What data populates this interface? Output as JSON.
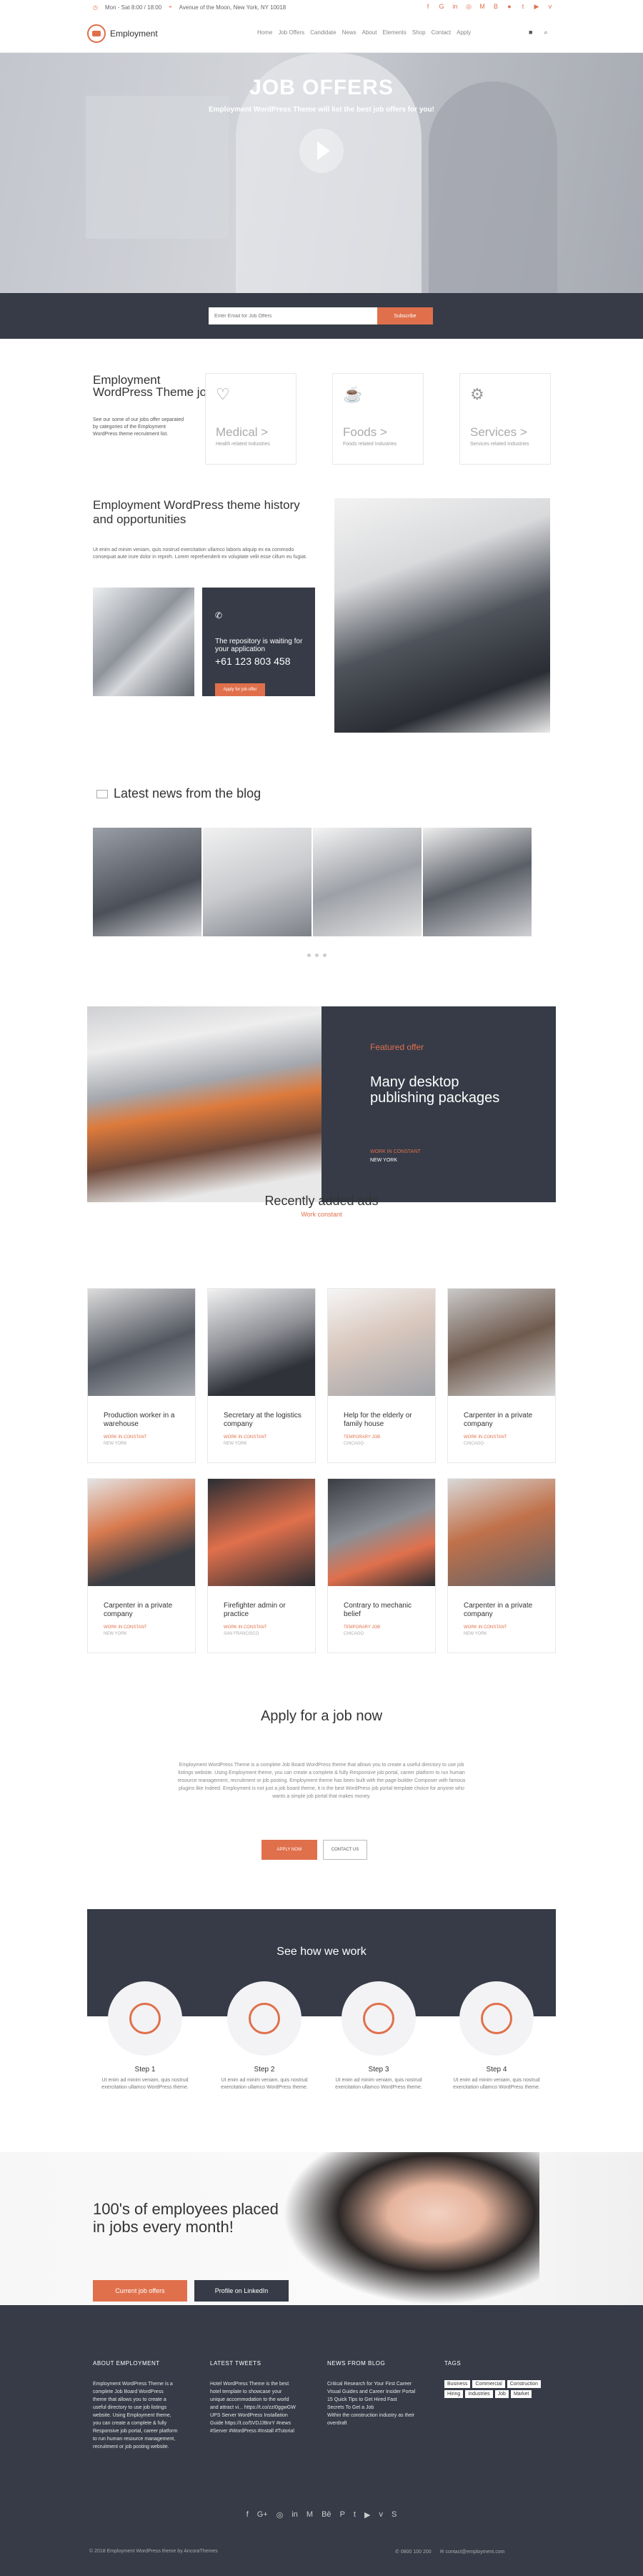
{
  "topbar": {
    "hours": "Mon - Sat 8:00 / 18:00",
    "address": "Avenue of the Moon, New York, NY 10018"
  },
  "brand": {
    "name": "Employment"
  },
  "menu": [
    "Home",
    "Job Offers",
    "Candidate",
    "News",
    "About",
    "Elements",
    "Shop",
    "Contact",
    "Apply"
  ],
  "hero": {
    "title": "JOB OFFERS",
    "subtitle": "Employment WordPress Theme will list the best job offers for you!",
    "email_placeholder": "Enter Email for Job Offers",
    "subscribe": "Subscribe"
  },
  "jobs": {
    "title": "Employment WordPress Theme jobs",
    "desc": "See our some of our jobs offer separated by categories of the Employment WordPress theme recruitment list.",
    "categories": [
      {
        "name": "Medical >",
        "sub": "Health related Industries"
      },
      {
        "name": "Foods >",
        "sub": "Foods related Industries"
      },
      {
        "name": "Services >",
        "sub": "Services related Industries"
      }
    ]
  },
  "history": {
    "title": "Employment WordPress theme history and opportunities",
    "desc": "Ut enim ad minim veniam, quis nostrud exercitation ullamco laboris aliquip ex ea commodo consequat aute irure dolor in repreh. Lorem reprehenderit ex voluptate velit esse cillum eu fugiat.",
    "repo_text": "The repository is waiting for your application",
    "phone": "+61 123 803 458",
    "apply": "Apply for job offer"
  },
  "blog": {
    "title": "Latest news from the blog"
  },
  "featured": {
    "label": "Featured offer",
    "title": "Many desktop publishing packages",
    "company": "WORK IN CONSTANT",
    "location": "NEW YORK"
  },
  "ads": {
    "title": "Recently added ads",
    "subtitle": "Work constant",
    "items": [
      {
        "title": "Production worker in a warehouse",
        "company": "WORK IN CONSTANT",
        "location": "NEW YORK"
      },
      {
        "title": "Secretary at the logistics company",
        "company": "WORK IN CONSTANT",
        "location": "NEW YORK"
      },
      {
        "title": "Help for the elderly or family house",
        "company": "TEMPORARY JOB",
        "location": "CHICAGO"
      },
      {
        "title": "Carpenter in a private company",
        "company": "WORK IN CONSTANT",
        "location": "CHICAGO"
      },
      {
        "title": "Carpenter in a private company",
        "company": "WORK IN CONSTANT",
        "location": "NEW YORK"
      },
      {
        "title": "Firefighter admin or practice",
        "company": "WORK IN CONSTANT",
        "location": "SAN FRANCISCO"
      },
      {
        "title": "Contrary to mechanic belief",
        "company": "TEMPORARY JOB",
        "location": "CHICAGO"
      },
      {
        "title": "Carpenter in a private company",
        "company": "WORK IN CONSTANT",
        "location": "NEW YORK"
      }
    ]
  },
  "apply": {
    "title": "Apply for a job now",
    "desc": "Employment WordPress Theme is a complete Job Board WordPress theme that allows you to create a useful directory to use job listings website. Using Employment theme, you can create a complete & fully Responsive job portal, career platform to run human resource management, recruitment or job posting. Employment theme has been built with the page-builder Composer with famous plugins like Indeed. Employment is not just a job board theme, it is the best WordPress job portal template choice for anyone who wants a simple job portal that makes money.",
    "apply_btn": "APPLY NOW",
    "contact_btn": "CONTACT US"
  },
  "how": {
    "title": "See how we work",
    "steps": [
      {
        "title": "Step 1",
        "desc": "Ut enim ad minim veniam, quis nostrud exercitation ullamco WordPress theme."
      },
      {
        "title": "Step 2",
        "desc": "Ut enim ad minim veniam, quis nostrud exercitation ullamco WordPress theme."
      },
      {
        "title": "Step 3",
        "desc": "Ut enim ad minim veniam, quis nostrud exercitation ullamco WordPress theme."
      },
      {
        "title": "Step 4",
        "desc": "Ut enim ad minim veniam, quis nostrud exercitation ullamco WordPress theme."
      }
    ]
  },
  "promo": {
    "title": "100's of employees placed in jobs every month!",
    "btn1": "Current job offers",
    "btn2": "Profile on LinkedIn"
  },
  "footer": {
    "about_head": "ABOUT EMPLOYMENT",
    "about": "Employment WordPress Theme is a complete Job Board WordPress theme that allows you to create a useful directory to use job listings website. Using Employment theme, you can create a complete & fully Responsive job portal, career platform to run human resource management, recruitment or job posting website.",
    "tweets_head": "LATEST TWEETS",
    "tweets": "Hotel WordPress Theme is the best hotel template to showcase your unique accommodation to the world and attract vi... https://t.co/zzI0ggwGW\nUPS Server WordPress Installation Guide https://t.co/5VDJJBnrY #news #Server #WordPress #Install #Tutorial",
    "news_head": "NEWS FROM BLOG",
    "news": [
      "Critical Research for Your First Career",
      "Visual Guides and Career Insider Portal",
      "15 Quick Tips to Get Hired Fast",
      "Secrets To Get a Job",
      "Within the construction industry as their overdraft"
    ],
    "tags_head": "TAGS",
    "tags": [
      "Business",
      "Commercial",
      "Construction",
      "Hiring",
      "Industries",
      "Job",
      "Market"
    ],
    "copyright": "© 2018 Employment WordPress theme by AncoraThemes",
    "phone": "0800 100 200",
    "email": "contact@employment.com"
  }
}
